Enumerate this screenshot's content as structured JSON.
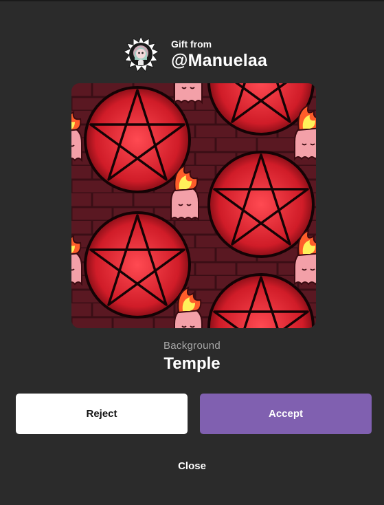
{
  "sender": {
    "gift_label": "Gift from",
    "username": "@Manuelaa"
  },
  "item": {
    "type_label": "Background",
    "name": "Temple"
  },
  "actions": {
    "reject_label": "Reject",
    "accept_label": "Accept",
    "close_label": "Close"
  },
  "colors": {
    "background": "#2b2b2b",
    "accept": "#8060b0",
    "reject": "#ffffff",
    "pattern_red": "#d81f2b",
    "flame_yellow": "#fff15a",
    "ghost_pink": "#f4a3aa"
  },
  "icons": {
    "avatar": "spiked-badge-avatar",
    "preview": "temple-pentagram-pattern"
  }
}
